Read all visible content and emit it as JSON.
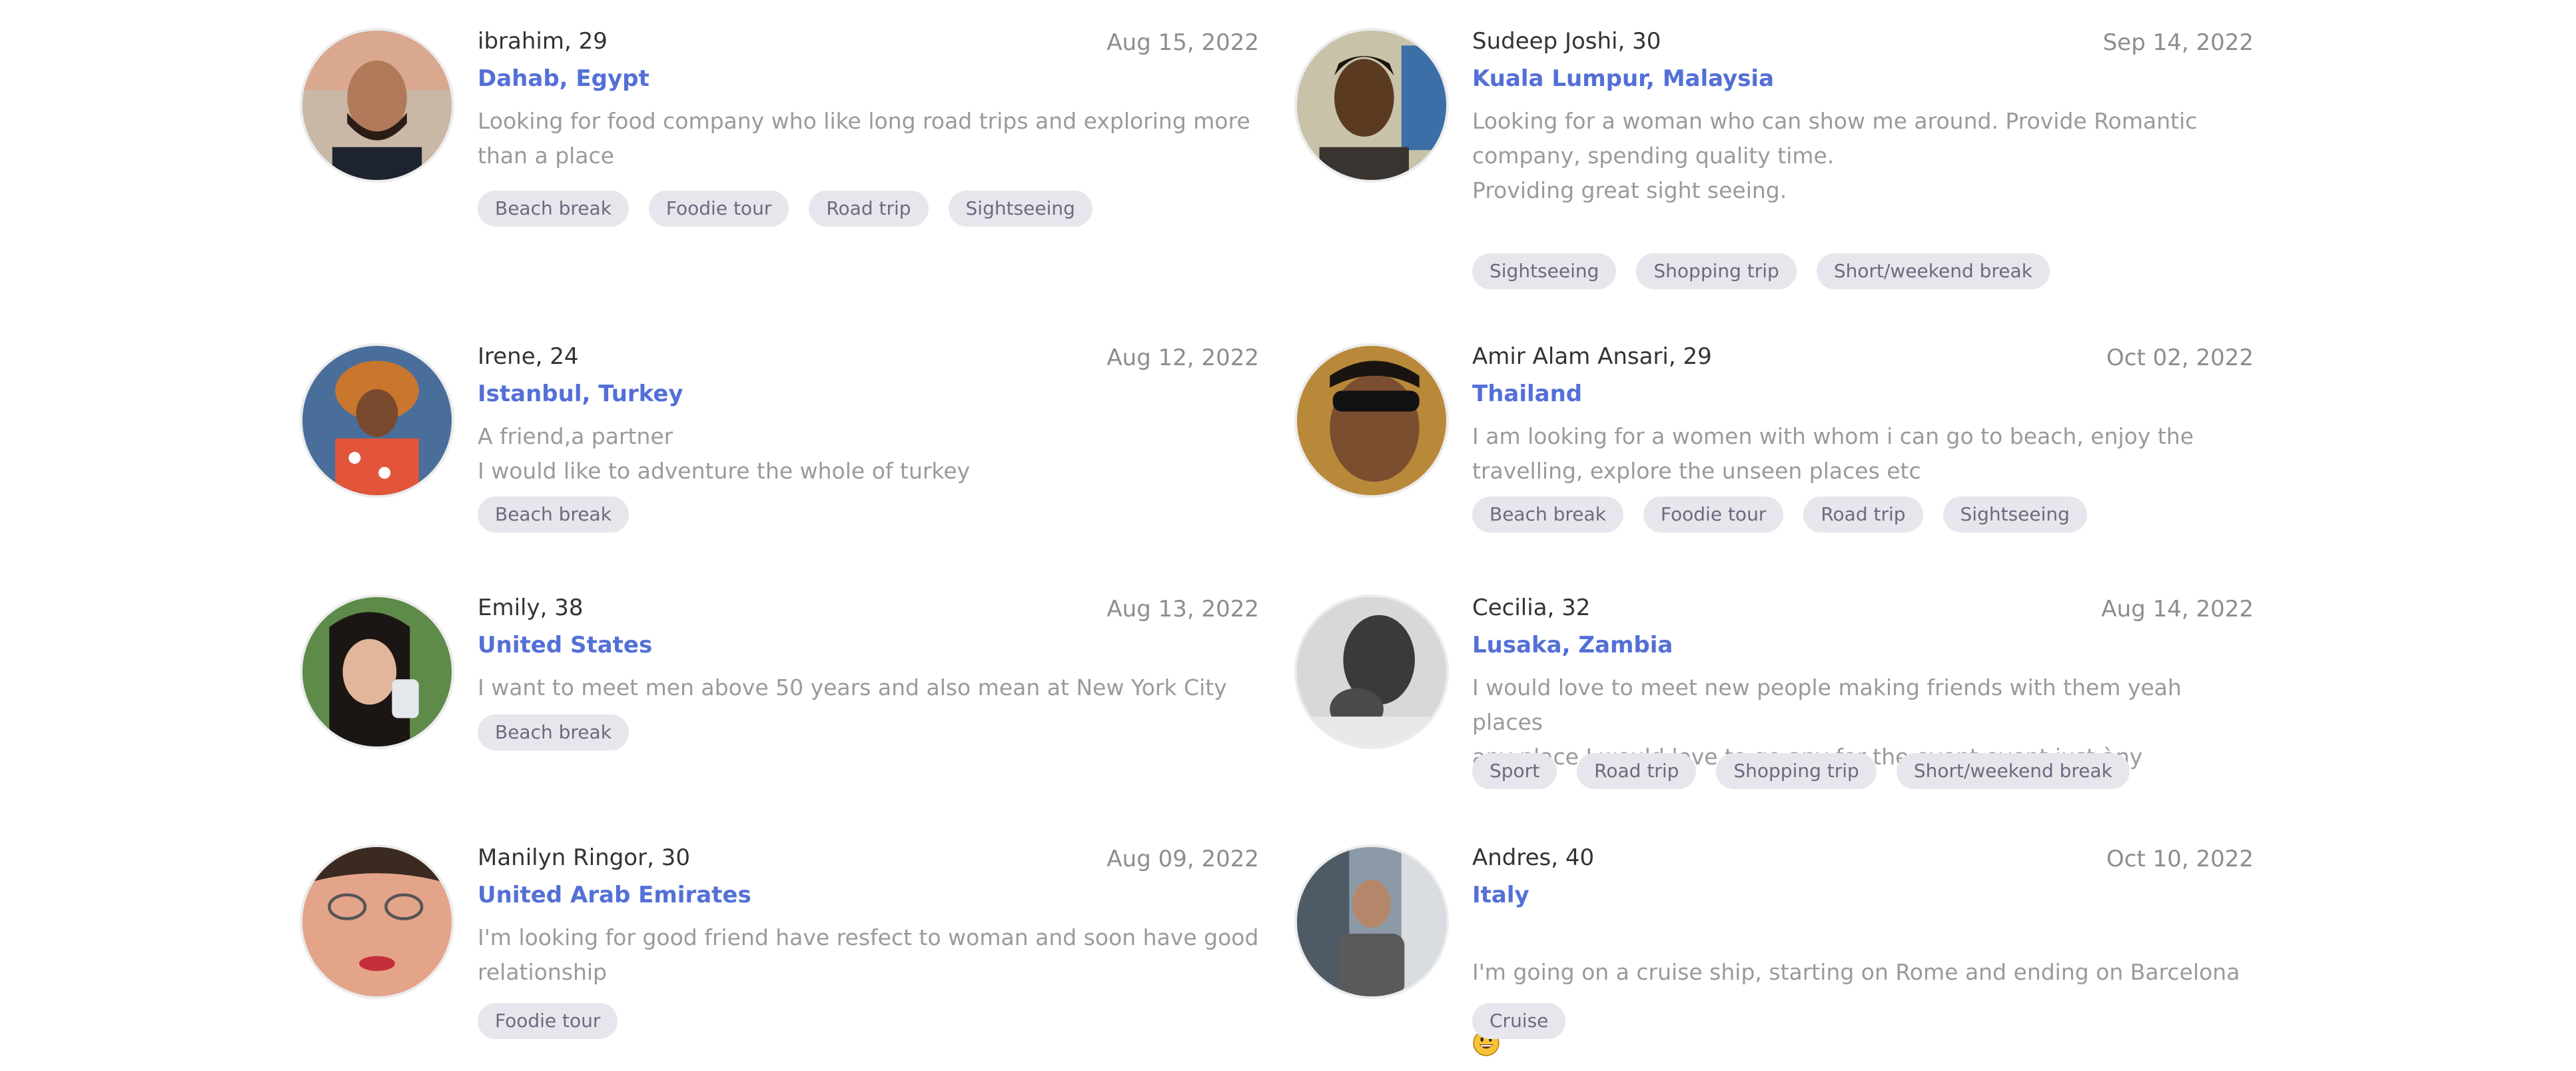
{
  "profiles": [
    {
      "name": "ibrahim, 29",
      "date": "Aug 15, 2022",
      "location": "Dahab, Egypt",
      "description": "Looking for food company who like long road trips and exploring more\nthan a place",
      "tags": [
        "Beach break",
        "Foodie tour",
        "Road trip",
        "Sightseeing"
      ]
    },
    {
      "name": "Sudeep Joshi, 30",
      "date": "Sep 14, 2022",
      "location": "Kuala Lumpur, Malaysia",
      "description": "Looking for a woman who can show me around. Provide Romantic\ncompany, spending quality time.\nProviding great sight seeing.",
      "tags": [
        "Sightseeing",
        "Shopping trip",
        "Short/weekend break"
      ]
    },
    {
      "name": "Irene, 24",
      "date": "Aug 12, 2022",
      "location": "Istanbul, Turkey",
      "description": "A friend,a partner\nI would like to adventure the whole of turkey",
      "tags": [
        "Beach break"
      ]
    },
    {
      "name": "Amir Alam Ansari, 29",
      "date": "Oct 02, 2022",
      "location": "Thailand",
      "description": "I am looking for a women with whom i can go to beach, enjoy the\ntravelling, explore the unseen places etc",
      "tags": [
        "Beach break",
        "Foodie tour",
        "Road trip",
        "Sightseeing"
      ]
    },
    {
      "name": "Emily, 38",
      "date": "Aug 13, 2022",
      "location": "United States",
      "description": "I want to meet men above 50 years and also mean at New York City",
      "tags": [
        "Beach break"
      ]
    },
    {
      "name": "Cecilia, 32",
      "date": "Aug 14, 2022",
      "location": "Lusaka, Zambia",
      "description": "I would love to meet new people making friends with them yeah places\nany place I would love to go any for the event event just àny",
      "tags": [
        "Sport",
        "Road trip",
        "Shopping trip",
        "Short/weekend break"
      ]
    },
    {
      "name": "Manilyn Ringor, 30",
      "date": "Aug 09, 2022",
      "location": "United Arab Emirates",
      "description": "I'm looking for good friend have resfect to woman and soon have good\nrelationship",
      "tags": [
        "Foodie tour"
      ]
    },
    {
      "name": "Andres, 40",
      "date": "Oct 10, 2022",
      "location": "Italy",
      "description": "I'm going on a cruise ship, starting on Rome and ending on Barcelona\n",
      "emoji": "grinning-face-emoji",
      "tags": [
        "Cruise"
      ]
    }
  ],
  "colors": {
    "location": "#5470d6",
    "date": "#8d8d8d",
    "description": "#9a9a9a",
    "tag_background": "#e6e6ec",
    "tag_text": "#6b6b80"
  }
}
